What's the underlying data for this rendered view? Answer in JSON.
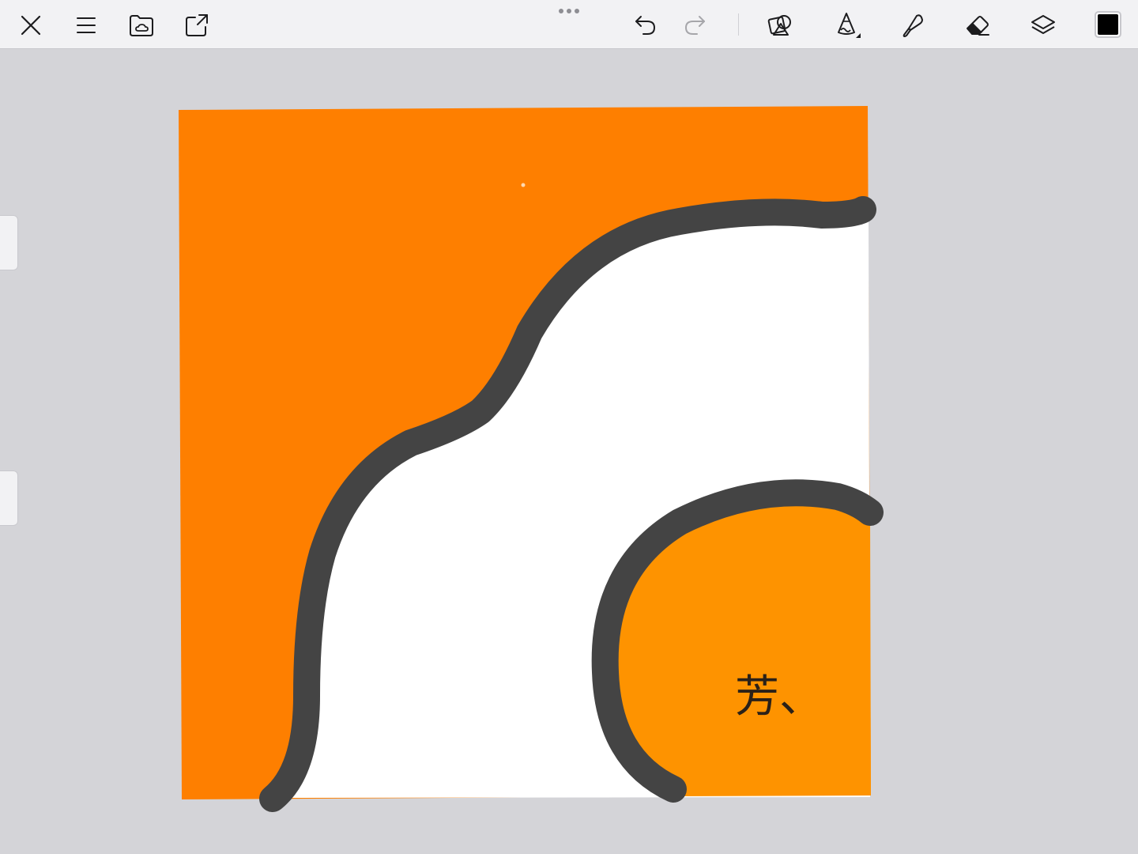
{
  "toolbar": {
    "buttons": [
      {
        "name": "close-button",
        "icon": "close-icon"
      },
      {
        "name": "menu-button",
        "icon": "menu-icon"
      },
      {
        "name": "gallery-button",
        "icon": "folder-cloud-icon"
      },
      {
        "name": "share-button",
        "icon": "share-icon"
      },
      {
        "name": "undo-button",
        "icon": "undo-icon"
      },
      {
        "name": "redo-button",
        "icon": "redo-icon",
        "disabled": true
      },
      {
        "name": "shapes-tool-button",
        "icon": "shapes-icon"
      },
      {
        "name": "pencil-tool-button",
        "icon": "pencil-icon"
      },
      {
        "name": "fill-tool-button",
        "icon": "fill-icon"
      },
      {
        "name": "eraser-tool-button",
        "icon": "eraser-icon"
      },
      {
        "name": "layers-button",
        "icon": "layers-icon"
      }
    ],
    "current_color": "#000000"
  },
  "canvas": {
    "background_color": "#fe7f00",
    "egg_white_color": "#ffffff",
    "yolk_color": "#fe9300",
    "outline_color": "#444444",
    "signature_text": "芳、"
  },
  "colors": {
    "toolbar_bg": "#f2f2f4",
    "workspace_bg": "#d4d4d8",
    "icon_color": "#1c1c1e",
    "disabled_icon_color": "#a6a6aa"
  }
}
